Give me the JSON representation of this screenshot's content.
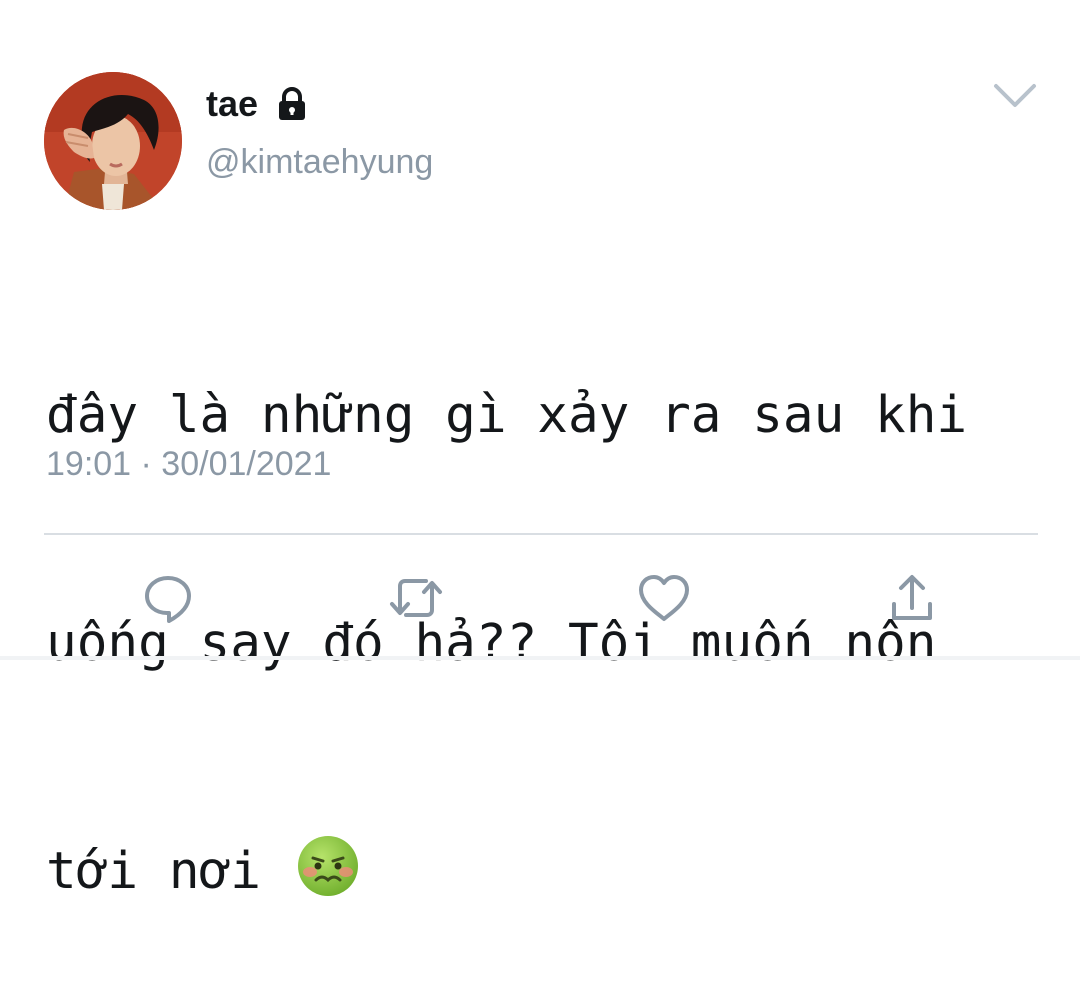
{
  "user": {
    "display_name": "tae",
    "handle": "@kimtaehyung",
    "avatar_icon": "profile-photo",
    "protected_icon": "lock-icon"
  },
  "tweet": {
    "lines": [
      "đây là những gì xảy ra sau khi",
      "uống say đó hả?? Tôi muốn nôn",
      "tới nơi"
    ],
    "emoji": "nauseated-face",
    "timestamp": "19:01 · 30/01/2021"
  },
  "actions": [
    {
      "icon": "reply-icon"
    },
    {
      "icon": "retweet-icon"
    },
    {
      "icon": "like-icon"
    },
    {
      "icon": "share-icon"
    }
  ],
  "menu_icon": "chevron-down-icon",
  "colors": {
    "text": "#14171a",
    "secondary": "#8b98a5",
    "divider": "#d9dee3",
    "icon": "#8b98a5"
  }
}
